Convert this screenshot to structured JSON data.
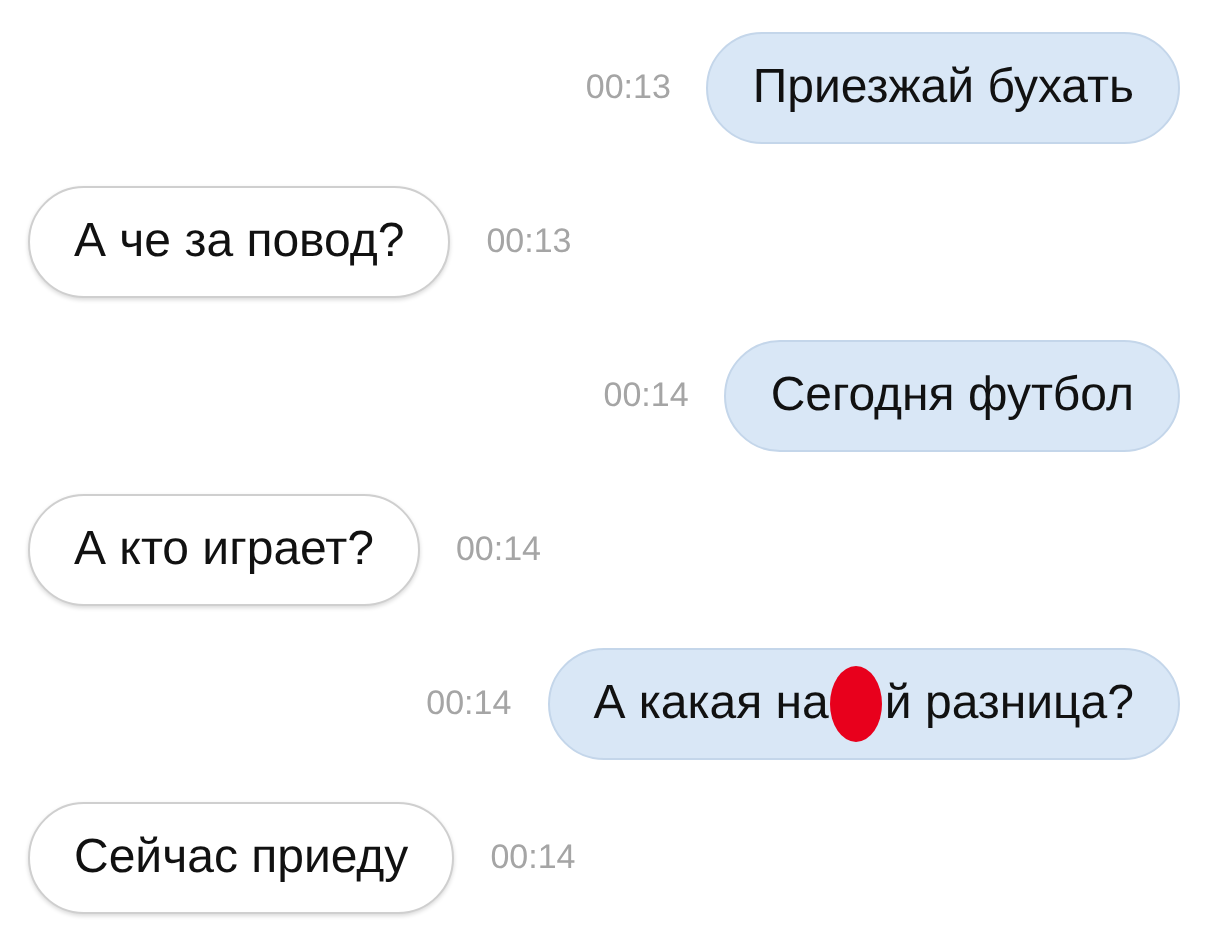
{
  "messages": [
    {
      "kind": "outgoing",
      "parts": [
        {
          "kind": "text",
          "text": "Приезжай бухать"
        }
      ],
      "time": "00:13"
    },
    {
      "kind": "incoming",
      "parts": [
        {
          "kind": "text",
          "text": "А че за повод?"
        }
      ],
      "time": "00:13"
    },
    {
      "kind": "outgoing",
      "parts": [
        {
          "kind": "text",
          "text": "Сегодня футбол"
        }
      ],
      "time": "00:14"
    },
    {
      "kind": "incoming",
      "parts": [
        {
          "kind": "text",
          "text": "А кто играет?"
        }
      ],
      "time": "00:14"
    },
    {
      "kind": "outgoing",
      "parts": [
        {
          "kind": "text",
          "text": "А какая на"
        },
        {
          "kind": "censor"
        },
        {
          "kind": "text",
          "text": "й разница?"
        }
      ],
      "time": "00:14"
    },
    {
      "kind": "incoming",
      "parts": [
        {
          "kind": "text",
          "text": "Сейчас приеду"
        }
      ],
      "time": "00:14"
    }
  ]
}
